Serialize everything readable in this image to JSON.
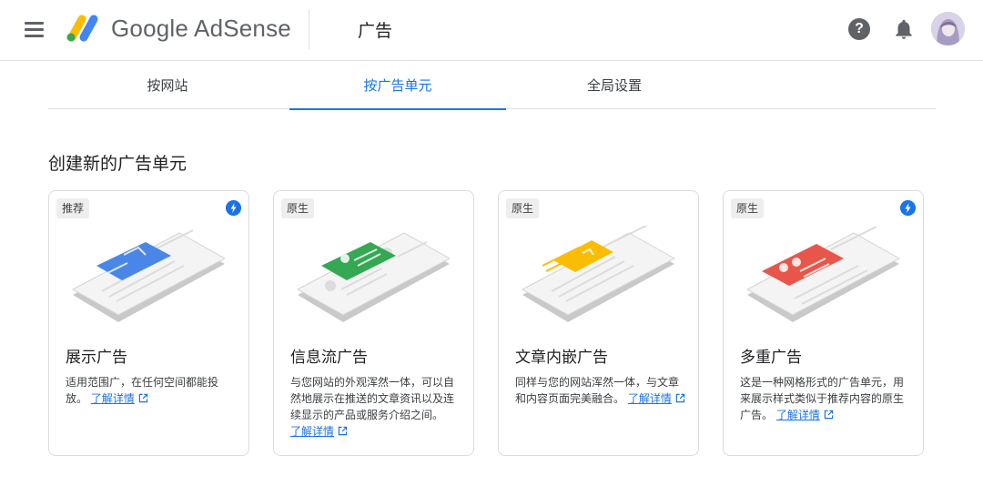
{
  "header": {
    "brand": "Google AdSense",
    "page_title": "广告",
    "help_glyph": "?"
  },
  "tabs": [
    {
      "label": "按网站",
      "active": false
    },
    {
      "label": "按广告单元",
      "active": true
    },
    {
      "label": "全局设置",
      "active": false
    }
  ],
  "section_title": "创建新的广告单元",
  "colors": {
    "accent": "#1a73e8",
    "display_ad": "#4285f4",
    "infeed_ad": "#34a853",
    "inarticle_ad": "#fbbc04",
    "multiplex_ad": "#ea4335"
  },
  "cards": [
    {
      "badge": "推荐",
      "title": "展示广告",
      "desc": "适用范围广，在任何空间都能投放。",
      "link": "了解详情",
      "icon": "display-ad-illustration"
    },
    {
      "badge": "原生",
      "title": "信息流广告",
      "desc": "与您网站的外观浑然一体，可以自然地展示在推送的文章资讯以及连续显示的产品或服务介绍之间。",
      "link": "了解详情",
      "icon": "infeed-ad-illustration"
    },
    {
      "badge": "原生",
      "title": "文章内嵌广告",
      "desc": "同样与您的网站浑然一体，与文章和内容页面完美融合。",
      "link": "了解详情",
      "icon": "inarticle-ad-illustration"
    },
    {
      "badge": "原生",
      "title": "多重广告",
      "desc": "这是一种网格形式的广告单元，用来展示样式类似于推荐内容的原生广告。",
      "link": "了解详情",
      "icon": "multiplex-ad-illustration"
    }
  ]
}
